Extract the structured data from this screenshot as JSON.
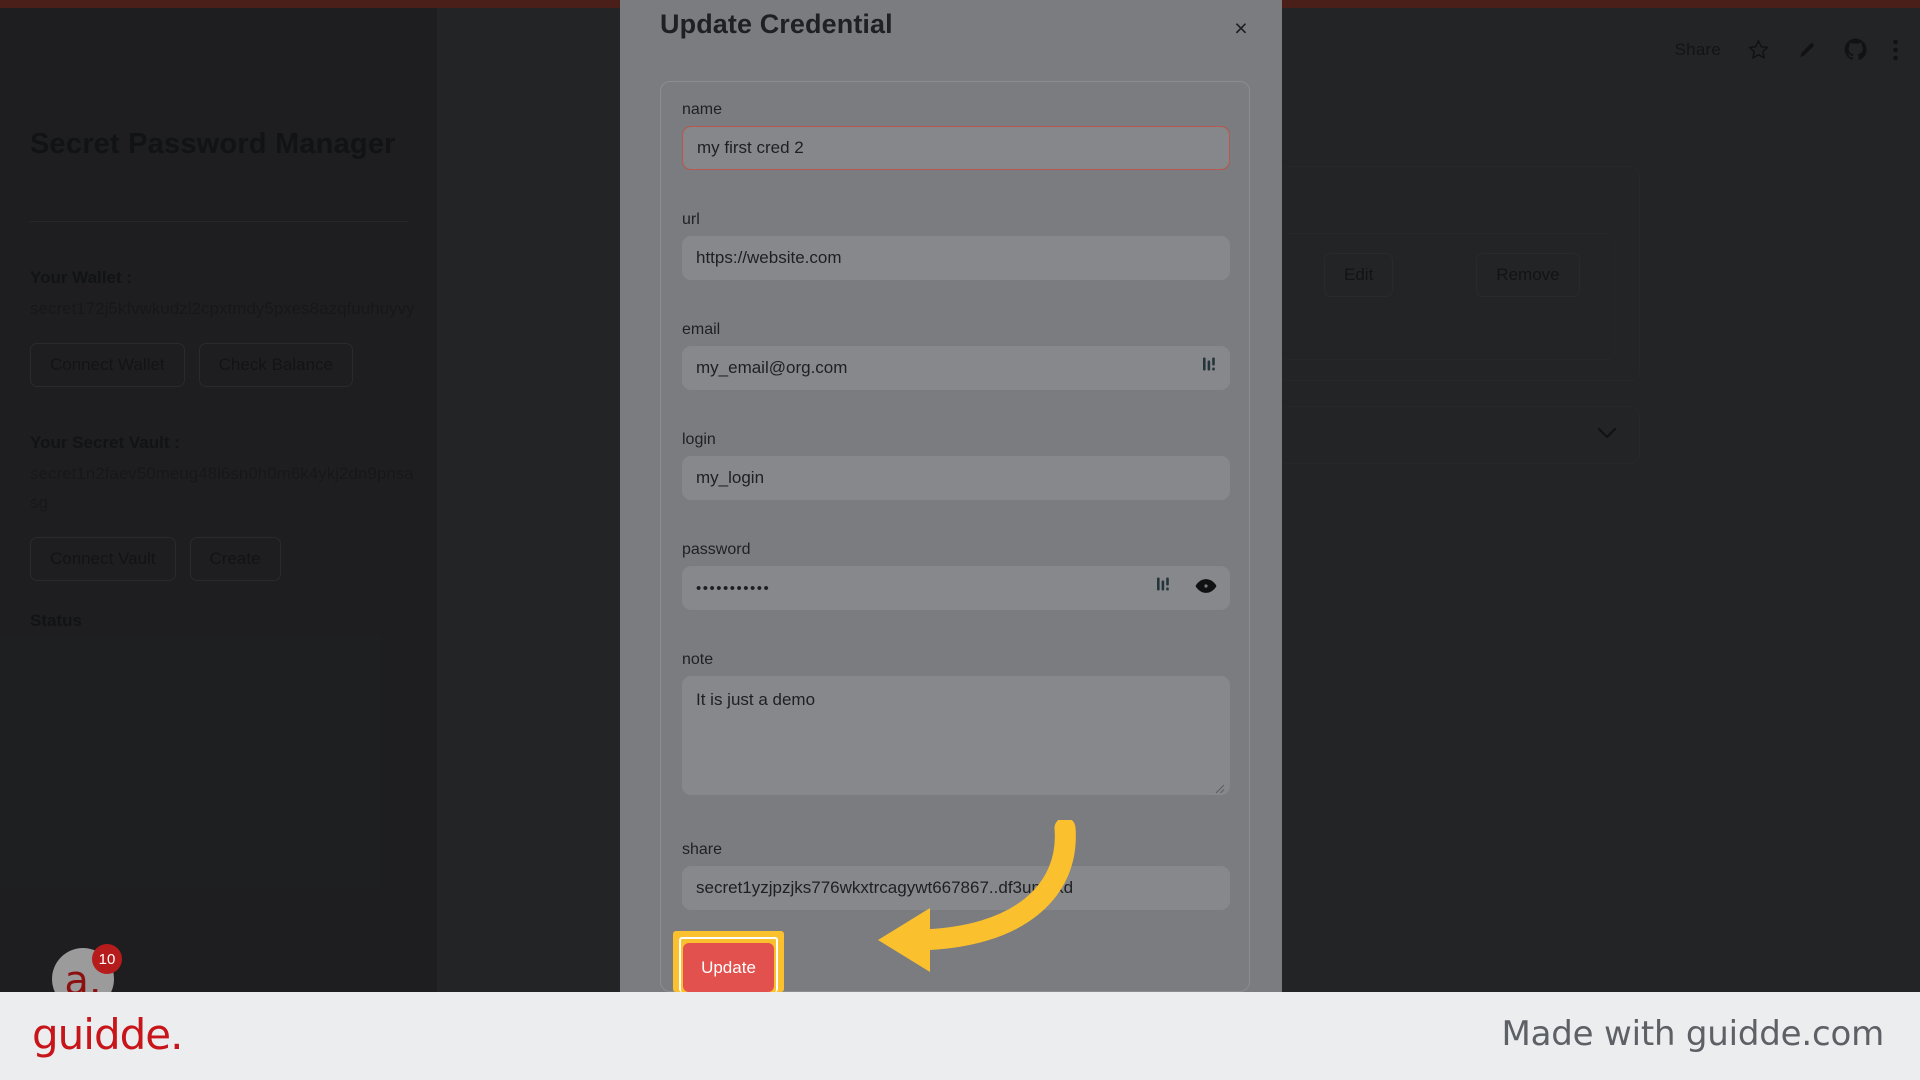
{
  "app": {
    "title": "Secret Password Manager",
    "wallet_label": "Your Wallet :",
    "wallet_address": "secret172j5kfvwkudzl2cpxtmdy5pxes8azqfuuhuyvy",
    "vault_label": "Your Secret Vault :",
    "vault_address": "secret1n2faev50meug48l6sn0h0m6k4ykj2dn9pnsasg",
    "status_label": "Status",
    "buttons": {
      "connect_wallet": "Connect Wallet",
      "check_balance": "Check Balance",
      "connect_vault": "Connect Vault",
      "create": "Create"
    }
  },
  "header": {
    "share_label": "Share",
    "icons": [
      "star-icon",
      "pencil-icon",
      "github-icon",
      "kebab-menu-icon"
    ]
  },
  "credential_card": {
    "edit_label": "Edit",
    "remove_label": "Remove"
  },
  "modal": {
    "title": "Update Credential",
    "close_label": "×",
    "fields": [
      {
        "key": "name",
        "label": "name",
        "value": "my first cred 2",
        "focused": true
      },
      {
        "key": "url",
        "label": "url",
        "value": "https://website.com",
        "focused": false
      },
      {
        "key": "email",
        "label": "email",
        "value": "my_email@org.com",
        "focused": false
      },
      {
        "key": "login",
        "label": "login",
        "value": "my_login",
        "focused": false
      },
      {
        "key": "password",
        "label": "password",
        "value": "•••••••••••",
        "focused": false
      },
      {
        "key": "note",
        "label": "note",
        "value": "It is just a demo",
        "focused": false
      },
      {
        "key": "share",
        "label": "share",
        "value": "secret1yzjpzjks776wkxtrcagywt667867..df3um0kd",
        "focused": false
      }
    ],
    "submit_label": "Update"
  },
  "guidde": {
    "badge_letter": "a.",
    "badge_count": "10",
    "logo": "guidde.",
    "made_with": "Made with guidde.com"
  },
  "colors": {
    "accent_red": "#e2514e",
    "highlight_yellow": "#fbc02d",
    "brand_red": "#c7151a"
  }
}
